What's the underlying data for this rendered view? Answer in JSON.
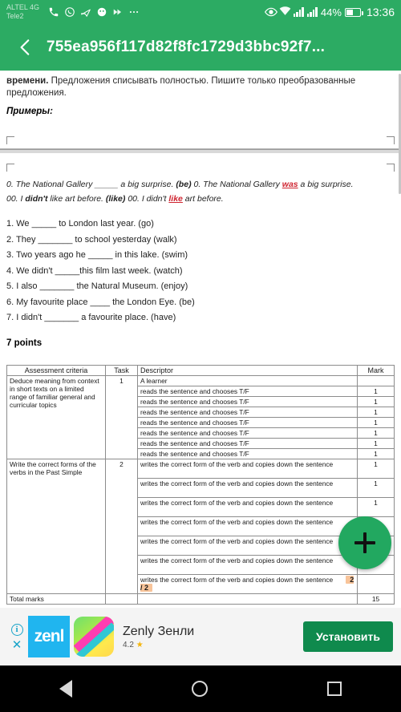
{
  "status_bar": {
    "carrier_line1": "ALTEL 4G",
    "carrier_line2": "Tele2",
    "icons": [
      "phone-icon",
      "whatsapp-icon",
      "telegram-icon",
      "app-icon",
      "send-icon",
      "more-icon"
    ],
    "right_icons": [
      "eye-icon",
      "wifi-icon",
      "signal-icon",
      "signal2-icon"
    ],
    "battery_percent": "44%",
    "time": "13:36"
  },
  "app_bar": {
    "back_icon": "back-chevron-icon",
    "title": "755ea956f117d82f8fc1729d3bbc92f7..."
  },
  "document": {
    "intro_bold": "времени.",
    "intro_rest": " Предложения списывать полностью. Пишите только преобразованные предложения.",
    "examples_label": "Примеры:",
    "example_lines": [
      {
        "pre": "0. The National Gallery ",
        "blank": "_____",
        "mid": " a big surprise. ",
        "cue": "(be)",
        "after": " 0. The National Gallery ",
        "answer": "was",
        "tail": " a big surprise."
      },
      {
        "pre": "00. I ",
        "bold": "didn't",
        "mid": " like art before. ",
        "cue": "(like)",
        "after": " 00. I didn't ",
        "answer": "like",
        "tail": " art before."
      }
    ],
    "questions": [
      "1. We _____ to London last year. (go)",
      "2. They _______ to school yesterday (walk)",
      "3. Two years ago he _____ in this lake. (swim)",
      "4. We didn't _____this film last week. (watch)",
      "5. I also _______ the Natural Museum. (enjoy)",
      "6. My favourite place ____ the London Eye. (be)",
      "7. I didn't _______ a favourite place. (have)"
    ],
    "points": "7 points"
  },
  "rubric_table": {
    "headers": [
      "Assessment criteria",
      "Task",
      "Descriptor",
      "Mark"
    ],
    "subheader_descriptor": "A learner",
    "groups": [
      {
        "criteria": "Deduce meaning from context in short texts on a limited range of familiar general and curricular topics",
        "task": "1",
        "descriptor": "reads the sentence and chooses T/F",
        "mark": "1",
        "rows": 7
      },
      {
        "criteria": "Write the correct forms of the verbs in the Past Simple",
        "task": "2",
        "descriptor": "writes the correct form of the verb and copies down the sentence",
        "mark": "1",
        "rows": 7
      }
    ],
    "score_badge": "2 / 2",
    "total_label": "Total marks",
    "total_mark": "15"
  },
  "fab": {
    "icon": "plus-icon",
    "label": "+"
  },
  "ad": {
    "info_icon": "info-icon",
    "close_icon": "close-icon",
    "brand_badge": "zenl",
    "app_icon": "zenly-app-icon",
    "title": "Zenly Зенли",
    "rating": "4.2",
    "star_icon": "star-icon",
    "cta_label": "Установить"
  },
  "nav_bar": {
    "back_icon": "nav-back-icon",
    "home_icon": "nav-home-icon",
    "recents_icon": "nav-recents-icon"
  },
  "colors": {
    "brand_green": "#2cab63",
    "fab_green": "#22a860",
    "cta_green": "#0f8a4d",
    "highlight_orange": "#f8c49a",
    "answer_red": "#cf2430"
  }
}
